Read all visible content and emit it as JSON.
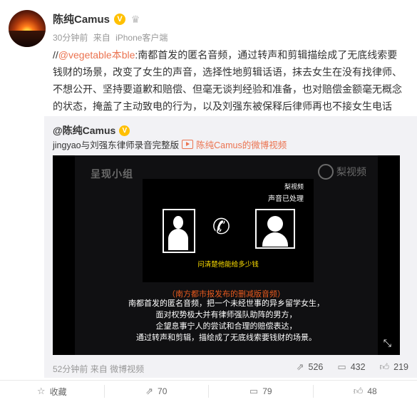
{
  "post": {
    "author": "陈纯Camus",
    "verified_badge": "V",
    "time": "30分钟前",
    "source_prefix": "来自",
    "source": "iPhone客户端",
    "content": {
      "prefix": "//",
      "mention": "@vegetable本ble",
      "text": ":南都首发的匿名音频，通过转声和剪辑描绘成了无底线索要钱财的场景，改变了女生的声音，选择性地剪辑话语，抹去女生在没有找律师、不想公开、坚持要道歉和赔偿、但毫无谈判经验和准备，也对赔偿金额毫无概念的状态，掩盖了主动致电的行为，以及刘强东被保释后律师再也不接女生电话"
    }
  },
  "repost": {
    "author": "@陈纯Camus",
    "verified_badge": "V",
    "text": "jingyao与刘强东律师录音完整版",
    "video_link": "陈纯Camus的微博视频",
    "video": {
      "watermark_left": "呈现小组",
      "watermark_right": "梨视频",
      "brand_small": "梨视频",
      "processed_label": "声音已处理",
      "caption": "问清楚他能给多少钱",
      "subtitle_title": "（南方都市报发布的删减版音频）",
      "subtitle_lines": [
        "南都首发的匿名音频，把一个未经世事的异乡留学女生，",
        "面对权势极大并有律师强队助阵的男方，",
        "企望息事宁人的尝试和合理的赔偿表达，",
        "通过转声和剪辑，描绘成了无底线索要钱财的场景。"
      ]
    },
    "time": "52分钟前",
    "source_prefix": "来自",
    "source": "微博视频",
    "actions": {
      "repost_count": "526",
      "comment_count": "432",
      "like_count": "219"
    }
  },
  "bottom_bar": {
    "favorite_label": "收藏",
    "repost_count": "70",
    "comment_count": "79",
    "like_count": "48"
  },
  "colors": {
    "mention": "#eb7350",
    "verified": "#ffc000",
    "repost_bg": "#f2f2f5"
  },
  "icons": {
    "favorite": "star-icon",
    "repost": "share-icon",
    "comment": "comment-icon",
    "like": "thumbs-up-icon",
    "expand": "expand-icon"
  }
}
